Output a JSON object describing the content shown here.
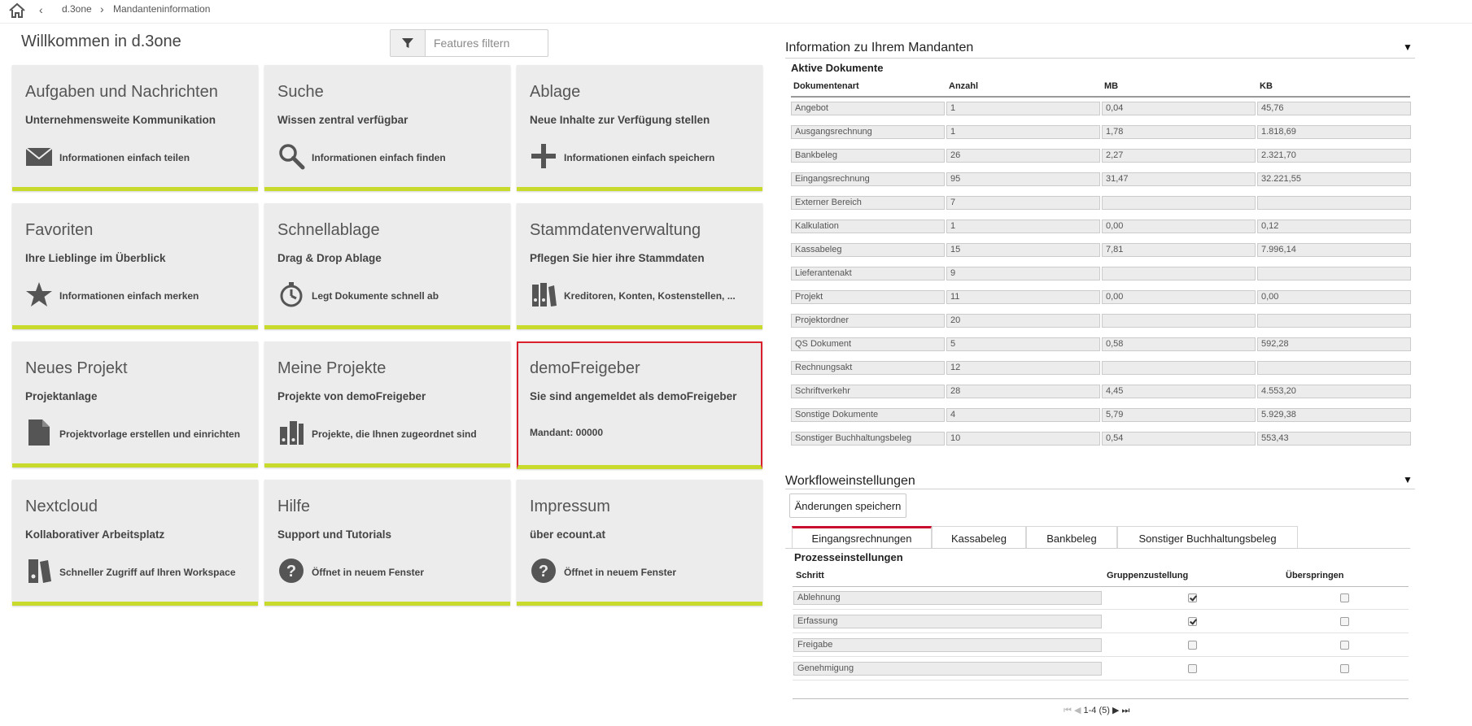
{
  "breadcrumb": {
    "root": "d.3one",
    "current": "Mandanteninformation"
  },
  "welcome": "Willkommen in d.3one",
  "filter": {
    "placeholder": "Features filtern"
  },
  "tiles": [
    {
      "title": "Aufgaben und Nachrichten",
      "subtitle": "Unternehmensweite Kommunikation",
      "link": "Informationen einfach teilen",
      "icon": "envelope-icon"
    },
    {
      "title": "Suche",
      "subtitle": "Wissen zentral verfügbar",
      "link": "Informationen einfach finden",
      "icon": "search-icon"
    },
    {
      "title": "Ablage",
      "subtitle": "Neue Inhalte zur Verfügung stellen",
      "link": "Informationen einfach speichern",
      "icon": "plus-icon"
    },
    {
      "title": "Favoriten",
      "subtitle": "Ihre Lieblinge im Überblick",
      "link": "Informationen einfach merken",
      "icon": "star-icon"
    },
    {
      "title": "Schnellablage",
      "subtitle": "Drag & Drop Ablage",
      "link": "Legt Dokumente schnell ab",
      "icon": "stopwatch-icon"
    },
    {
      "title": "Stammdatenverwaltung",
      "subtitle": "Pflegen Sie hier ihre Stammdaten",
      "link": "Kreditoren, Konten, Kostenstellen, ...",
      "icon": "binders-icon"
    },
    {
      "title": "Neues Projekt",
      "subtitle": "Projektanlage",
      "link": "Projektvorlage erstellen und einrichten",
      "icon": "document-icon"
    },
    {
      "title": "Meine Projekte",
      "subtitle": "Projekte von demoFreigeber",
      "link": "Projekte, die Ihnen zugeordnet sind",
      "icon": "folders-icon"
    },
    {
      "title": "demoFreigeber",
      "subtitle": "Sie sind angemeldet als demoFreigeber",
      "link": "Mandant: 00000",
      "icon": ""
    },
    {
      "title": "Nextcloud",
      "subtitle": "Kollaborativer Arbeitsplatz",
      "link": "Schneller Zugriff auf Ihren Workspace",
      "icon": "binder-icon"
    },
    {
      "title": "Hilfe",
      "subtitle": "Support und Tutorials",
      "link": "Öffnet in neuem Fenster",
      "icon": "help-icon"
    },
    {
      "title": "Impressum",
      "subtitle": "über ecount.at",
      "link": "Öffnet in neuem Fenster",
      "icon": "help-icon"
    }
  ],
  "info": {
    "title": "Information zu Ihrem Mandanten",
    "subtitle": "Aktive Dokumente",
    "columns": [
      "Dokumentenart",
      "Anzahl",
      "MB",
      "KB"
    ],
    "rows": [
      [
        "Angebot",
        "1",
        "0,04",
        "45,76"
      ],
      [
        "Ausgangsrechnung",
        "1",
        "1,78",
        "1.818,69"
      ],
      [
        "Bankbeleg",
        "26",
        "2,27",
        "2.321,70"
      ],
      [
        "Eingangsrechnung",
        "95",
        "31,47",
        "32.221,55"
      ],
      [
        "Externer Bereich",
        "7",
        "",
        ""
      ],
      [
        "Kalkulation",
        "1",
        "0,00",
        "0,12"
      ],
      [
        "Kassabeleg",
        "15",
        "7,81",
        "7.996,14"
      ],
      [
        "Lieferantenakt",
        "9",
        "",
        ""
      ],
      [
        "Projekt",
        "11",
        "0,00",
        "0,00"
      ],
      [
        "Projektordner",
        "20",
        "",
        ""
      ],
      [
        "QS Dokument",
        "5",
        "0,58",
        "592,28"
      ],
      [
        "Rechnungsakt",
        "12",
        "",
        ""
      ],
      [
        "Schriftverkehr",
        "28",
        "4,45",
        "4.553,20"
      ],
      [
        "Sonstige Dokumente",
        "4",
        "5,79",
        "5.929,38"
      ],
      [
        "Sonstiger Buchhaltungsbeleg",
        "10",
        "0,54",
        "553,43"
      ]
    ]
  },
  "workflow": {
    "title": "Workfloweinstellungen",
    "save_label": "Änderungen speichern",
    "tabs": [
      "Eingangsrechnungen",
      "Kassabeleg",
      "Bankbeleg",
      "Sonstiger Buchhaltungsbeleg"
    ],
    "subtitle": "Prozesseinstellungen",
    "columns": [
      "Schritt",
      "Gruppenzustellung",
      "Überspringen"
    ],
    "rows": [
      {
        "step": "Ablehnung",
        "group": true,
        "skip": false
      },
      {
        "step": "Erfassung",
        "group": true,
        "skip": false
      },
      {
        "step": "Freigabe",
        "group": false,
        "skip": false
      },
      {
        "step": "Genehmigung",
        "group": false,
        "skip": false
      }
    ],
    "pager": "1-4 (5)"
  }
}
